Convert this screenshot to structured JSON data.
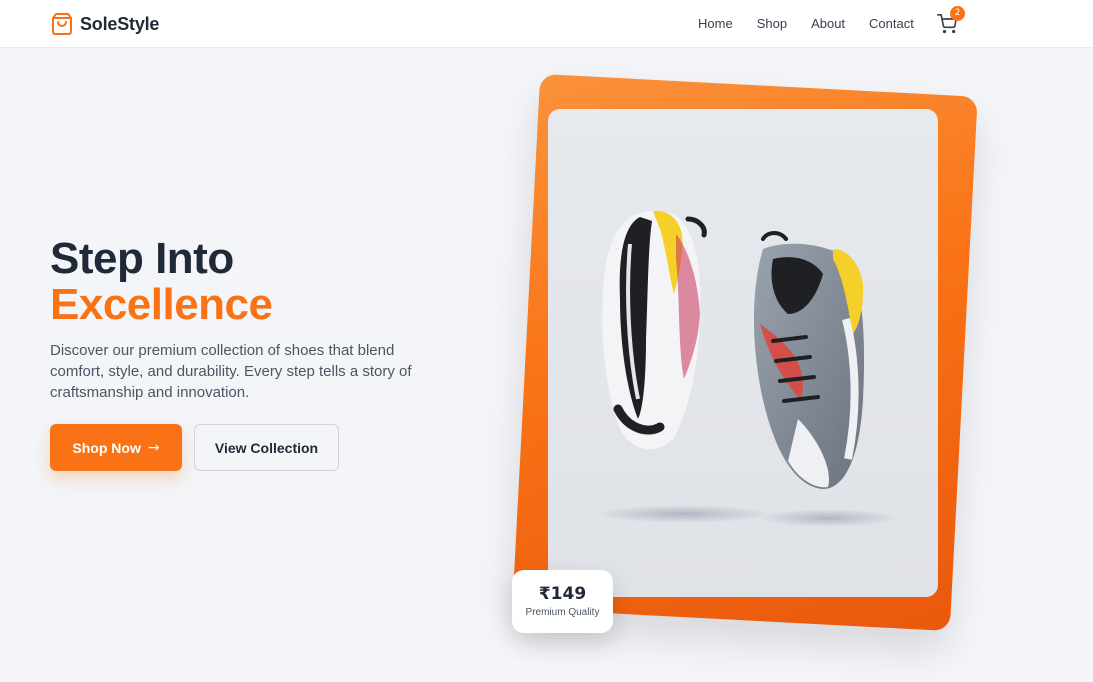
{
  "brand": {
    "name": "SoleStyle",
    "icon": "shopping-bag-icon"
  },
  "nav": {
    "links": [
      "Home",
      "Shop",
      "About",
      "Contact"
    ],
    "cart_icon": "cart-icon",
    "cart_count": "2"
  },
  "hero": {
    "title_line1": "Step Into",
    "title_line2": "Excellence",
    "description": "Discover our premium collection of shoes that blend comfort, style, and durability. Every step tells a story of craftsmanship and innovation.",
    "primary_button": "Shop Now",
    "primary_button_icon": "arrow-right-icon",
    "secondary_button": "View Collection"
  },
  "product": {
    "image": "sneaker-photo",
    "price": "₹149",
    "price_label": "Premium Quality"
  },
  "colors": {
    "accent": "#f97316",
    "text_dark": "#1f2937",
    "background": "#f3f5f8"
  }
}
